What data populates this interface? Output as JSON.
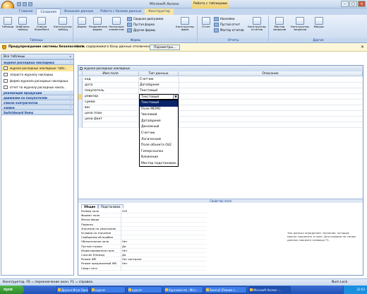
{
  "window": {
    "title": "Microsoft Access",
    "context_tab": "Работа с таблицами"
  },
  "tabs": [
    "Главная",
    "Создание",
    "Внешние данные",
    "Работа с базами данных",
    "Конструктор"
  ],
  "ribbon": {
    "groups": [
      "Таблицы",
      "Формы",
      "Отчеты",
      "Другие"
    ],
    "buttons": {
      "table": "Таблица",
      "table_templates": "Шаблоны таблиц",
      "sharepoint": "Списки SharePoint",
      "table_design": "Конструктор таблиц",
      "form": "Форма",
      "split_form": "Разделенная форма",
      "multiple_items": "Несколько элементов",
      "pivot_chart": "Сводная диаграмма",
      "blank_form": "Пустая форма",
      "more_forms": "Другие формы",
      "form_design": "Конструктор форм",
      "report": "Отчет",
      "labels": "Наклейки",
      "blank_report": "Пустой отчет",
      "report_wizard": "Мастер отчетов",
      "report_design": "Конструктор отчетов",
      "query_wizard": "Мастер запросов",
      "query_design": "Конструктор запросов",
      "macro": "Макрос"
    }
  },
  "security_bar": {
    "title": "Предупреждение системы безопасности",
    "message": "Часть содержимого базы данных отключено",
    "button": "Параметры..."
  },
  "nav": {
    "header": "Все таблицы",
    "groups": [
      {
        "label": "журнал расходных накладных",
        "items": [
          {
            "label": "журнал расходных накладных: табл...",
            "selected": true
          },
          {
            "label": "запросто журналу накладны",
            "selected": false
          },
          {
            "label": "форма журнала расходных накладных",
            "selected": false
          },
          {
            "label": "отчет по журналу расходных накла...",
            "selected": false
          }
        ]
      },
      {
        "label": "реализация продукции",
        "items": []
      },
      {
        "label": "движение по покупателям",
        "items": []
      },
      {
        "label": "список контрагентов",
        "items": []
      },
      {
        "label": "заявки",
        "items": []
      },
      {
        "label": "Switchboard Items",
        "items": []
      }
    ]
  },
  "document": {
    "title": "журнал расходных накладных",
    "columns": [
      "Имя поля",
      "Тип данных",
      "Описание"
    ],
    "rows": [
      {
        "name": "код",
        "type": "Счетчик"
      },
      {
        "name": "дата",
        "type": "Дата/время"
      },
      {
        "name": "покупатель",
        "type": "Текстовый"
      },
      {
        "name": "ревизор",
        "type": "Текстовый"
      },
      {
        "name": "сумма",
        "type": ""
      },
      {
        "name": "вес",
        "type": ""
      },
      {
        "name": "цена план",
        "type": ""
      },
      {
        "name": "цена факт",
        "type": ""
      }
    ],
    "combo_value": "Текстовый",
    "dropdown": [
      "Текстовый",
      "Поле MEMO",
      "Числовой",
      "Дата/время",
      "Денежный",
      "Счетчик",
      "Логический",
      "Поле объекта OLE",
      "Гиперссылка",
      "Вложение",
      "Мастер подстановок..."
    ],
    "properties_bar": "Свойства поля",
    "prop_tabs": [
      "Общие",
      "Подстановка"
    ],
    "props": [
      {
        "label": "Размер поля",
        "value": "255"
      },
      {
        "label": "Формат поля",
        "value": ""
      },
      {
        "label": "Маска ввода",
        "value": ""
      },
      {
        "label": "Подпись",
        "value": ""
      },
      {
        "label": "Значение по умолчанию",
        "value": ""
      },
      {
        "label": "Условие на значение",
        "value": ""
      },
      {
        "label": "Сообщение об ошибке",
        "value": ""
      },
      {
        "label": "Обязательное поле",
        "value": "Нет"
      },
      {
        "label": "Пустые строки",
        "value": "Да"
      },
      {
        "label": "Индексированное поле",
        "value": "Нет"
      },
      {
        "label": "Сжатие Юникод",
        "value": "Да"
      },
      {
        "label": "Режим IME",
        "value": "Нет контроля"
      },
      {
        "label": "Режим предложений IME",
        "value": "Нет"
      },
      {
        "label": "Смарт-теги",
        "value": ""
      }
    ],
    "hint": "Тип данных определяет значения, которые можно сохранить в поле. Для справки по типам данных нажмите клавишу F1."
  },
  "status": {
    "left": "Конструктор. F6 = переключение окон. F1 = справка.",
    "right": "Num Lock"
  },
  "taskbar": {
    "start": "пуск",
    "items": [
      "Друзья Игра Ориз...",
      "курсач",
      "курсач",
      "Курсовая по - Micr...",
      "Rossia2 [Режим с...",
      "Microsoft Access -..."
    ],
    "clock": "22:03"
  }
}
